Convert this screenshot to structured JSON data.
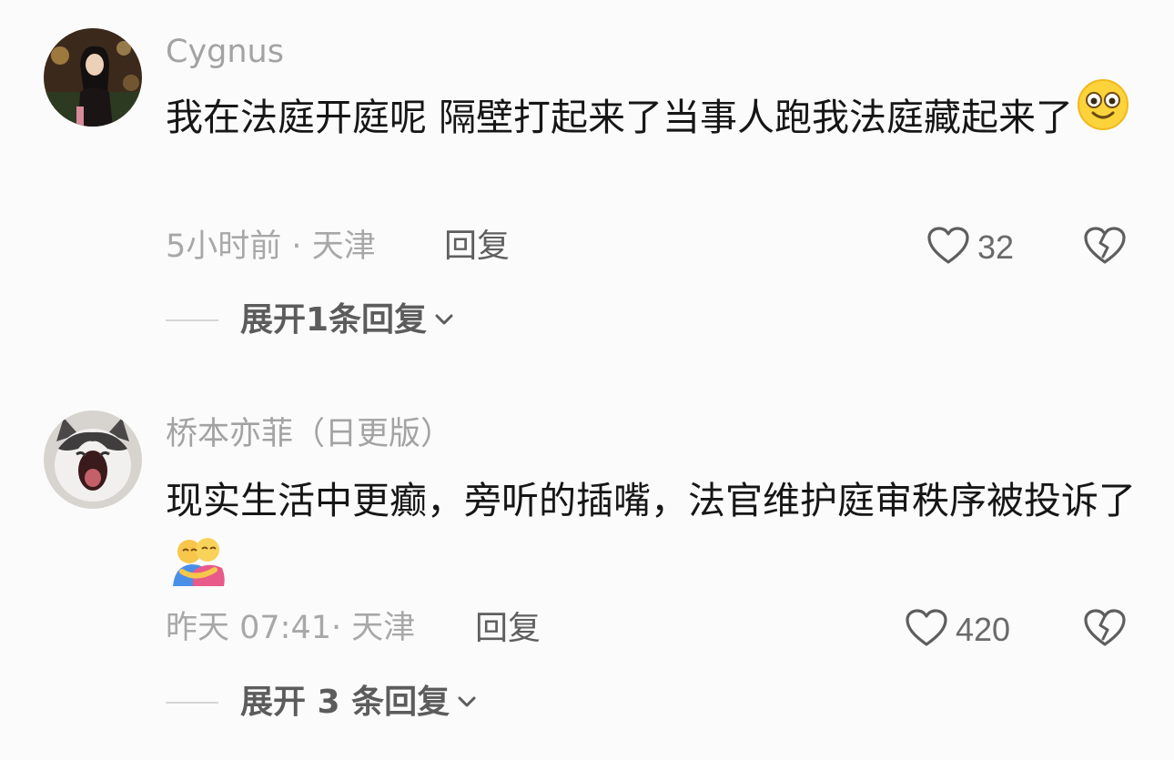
{
  "comments": [
    {
      "username": "Cygnus",
      "text": "我在法庭开庭呢 隔壁打起来了当事人跑我法庭藏起来了",
      "emoji": "flushed-smile-emoji",
      "time": "5小时前",
      "location": "天津",
      "reply_label": "回复",
      "likes": "32",
      "expand_label": "展开1条回复"
    },
    {
      "username": "桥本亦菲（日更版）",
      "text": "现实生活中更癫，旁听的插嘴，法官维护庭审秩序被投诉了",
      "emoji": "hugging-people-emoji",
      "time": "昨天 07:41",
      "location": "天津",
      "reply_label": "回复",
      "likes": "420",
      "expand_label": "展开 3 条回复"
    }
  ],
  "separator": "·",
  "icons": {
    "like": "heart-outline-icon",
    "dislike": "broken-heart-icon",
    "expand": "chevron-down-icon"
  },
  "colors": {
    "background": "#fbfbfb",
    "username": "#a3a3a3",
    "text": "#161616",
    "meta": "#a8a8a8",
    "action": "#5f5f5f"
  }
}
